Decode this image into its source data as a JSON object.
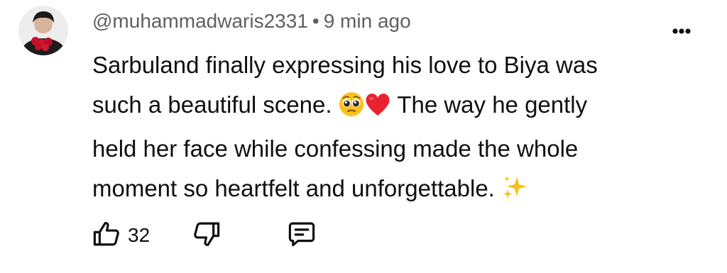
{
  "comment": {
    "author": "@muhammadwaris2331",
    "separator": "•",
    "time": "9 min ago",
    "lines": {
      "l1": "Sarbuland finally expressing his love to Biya was",
      "l2a": "such a beautiful scene.",
      "l2b": "The way he gently",
      "l3": "held her face while confessing made the whole",
      "l4": "moment so heartfelt and unforgettable."
    },
    "emojis": [
      "pleading-face-emoji",
      "red-heart-emoji",
      "sparkles-emoji"
    ]
  },
  "actions": {
    "like_count": "32",
    "icons": [
      "thumbs-up-icon",
      "thumbs-down-icon",
      "reply-icon",
      "more-vert-icon"
    ]
  },
  "colors": {
    "text": "#0f0f0f",
    "meta": "#606060",
    "heart": "#e8232f",
    "face": "#fcc21b",
    "sparkle": "#f4c21b"
  }
}
